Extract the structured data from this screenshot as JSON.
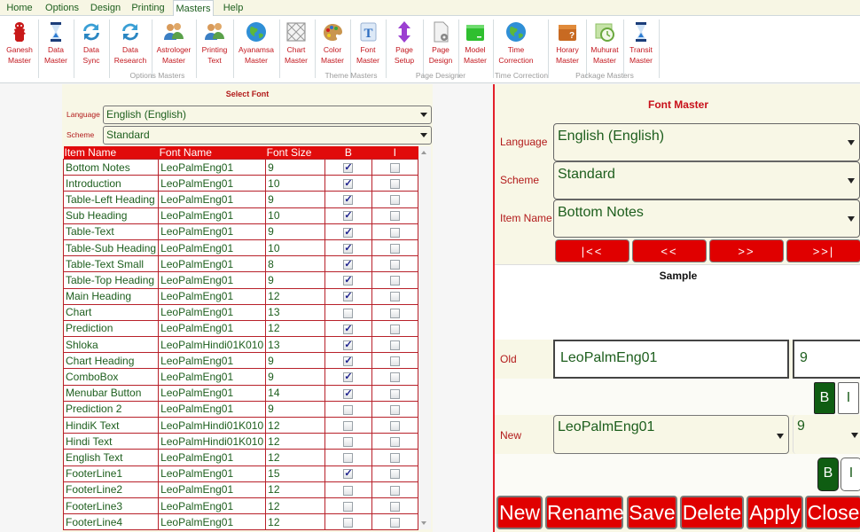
{
  "menu": {
    "tabs": [
      {
        "label": "Home",
        "active": false
      },
      {
        "label": "Options",
        "active": false
      },
      {
        "label": "Design",
        "active": false
      },
      {
        "label": "Printing",
        "active": false
      },
      {
        "label": "Masters",
        "active": true
      },
      {
        "label": "Help",
        "active": false
      }
    ]
  },
  "ribbon": {
    "buttons": [
      {
        "line1": "Ganesh",
        "line2": "Master",
        "icon": "ganesh-icon"
      },
      {
        "line1": "Data",
        "line2": "Master",
        "icon": "hourglass-icon"
      },
      {
        "line1": "Data",
        "line2": "Sync",
        "icon": "sync-icon"
      },
      {
        "line1": "Data",
        "line2": "Research",
        "icon": "sync-icon"
      },
      {
        "line1": "Astrologer",
        "line2": "Master",
        "icon": "users-icon"
      },
      {
        "line1": "Printing",
        "line2": "Text",
        "icon": "users-icon"
      },
      {
        "line1": "Ayanamsa",
        "line2": "Master",
        "icon": "globe-icon"
      },
      {
        "line1": "Chart",
        "line2": "Master",
        "icon": "chart-grid-icon"
      },
      {
        "line1": "Color",
        "line2": "Master",
        "icon": "palette-icon"
      },
      {
        "line1": "Font",
        "line2": "Master",
        "icon": "font-icon"
      },
      {
        "line1": "Page",
        "line2": "Setup",
        "icon": "vertical-arrows-icon"
      },
      {
        "line1": "Page",
        "line2": "Design",
        "icon": "page-gear-icon"
      },
      {
        "line1": "Model",
        "line2": "Master",
        "icon": "green-folder-icon"
      },
      {
        "line1": "Time",
        "line2": "Correction",
        "icon": "globe-icon"
      },
      {
        "line1": "Horary",
        "line2": "Master",
        "icon": "horary-box-icon"
      },
      {
        "line1": "Muhurat",
        "line2": "Master",
        "icon": "calendar-clock-icon"
      },
      {
        "line1": "Transit",
        "line2": "Master",
        "icon": "hourglass-icon"
      }
    ],
    "groups": [
      "Options Masters",
      "Theme Masters",
      "Page Designer",
      "Time Correction",
      "Package Masters"
    ]
  },
  "select_font": {
    "title": "Select Font",
    "language_label": "Language",
    "language_value": "English (English)",
    "scheme_label": "Scheme",
    "scheme_value": "Standard",
    "columns": [
      "Item Name",
      "Font Name",
      "Font Size",
      "B",
      "I"
    ],
    "rows": [
      {
        "item": "Bottom Notes",
        "font": "LeoPalmEng01",
        "size": "9",
        "bold": true,
        "italic": false
      },
      {
        "item": "Introduction",
        "font": "LeoPalmEng01",
        "size": "10",
        "bold": true,
        "italic": false
      },
      {
        "item": "Table-Left Heading",
        "font": "LeoPalmEng01",
        "size": "9",
        "bold": true,
        "italic": false
      },
      {
        "item": "Sub Heading",
        "font": "LeoPalmEng01",
        "size": "10",
        "bold": true,
        "italic": false
      },
      {
        "item": "Table-Text",
        "font": "LeoPalmEng01",
        "size": "9",
        "bold": true,
        "italic": false
      },
      {
        "item": "Table-Sub Heading",
        "font": "LeoPalmEng01",
        "size": "10",
        "bold": true,
        "italic": false
      },
      {
        "item": "Table-Text Small",
        "font": "LeoPalmEng01",
        "size": "8",
        "bold": true,
        "italic": false
      },
      {
        "item": "Table-Top Heading",
        "font": "LeoPalmEng01",
        "size": "9",
        "bold": true,
        "italic": false
      },
      {
        "item": "Main Heading",
        "font": "LeoPalmEng01",
        "size": "12",
        "bold": true,
        "italic": false
      },
      {
        "item": "Chart",
        "font": "LeoPalmEng01",
        "size": "13",
        "bold": false,
        "italic": false
      },
      {
        "item": "Prediction",
        "font": "LeoPalmEng01",
        "size": "12",
        "bold": true,
        "italic": false
      },
      {
        "item": "Shloka",
        "font": "LeoPalmHindi01K010",
        "size": "13",
        "bold": true,
        "italic": false
      },
      {
        "item": "Chart Heading",
        "font": "LeoPalmEng01",
        "size": "9",
        "bold": true,
        "italic": false
      },
      {
        "item": "ComboBox",
        "font": "LeoPalmEng01",
        "size": "9",
        "bold": true,
        "italic": false
      },
      {
        "item": "Menubar Button",
        "font": "LeoPalmEng01",
        "size": "14",
        "bold": true,
        "italic": false
      },
      {
        "item": "Prediction 2",
        "font": "LeoPalmEng01",
        "size": "9",
        "bold": false,
        "italic": false
      },
      {
        "item": "HindiK Text",
        "font": "LeoPalmHindi01K010",
        "size": "12",
        "bold": false,
        "italic": false
      },
      {
        "item": "Hindi Text",
        "font": "LeoPalmHindi01K010",
        "size": "12",
        "bold": false,
        "italic": false
      },
      {
        "item": "English Text",
        "font": "LeoPalmEng01",
        "size": "12",
        "bold": false,
        "italic": false
      },
      {
        "item": "FooterLine1",
        "font": "LeoPalmEng01",
        "size": "15",
        "bold": true,
        "italic": false
      },
      {
        "item": "FooterLine2",
        "font": "LeoPalmEng01",
        "size": "12",
        "bold": false,
        "italic": false
      },
      {
        "item": "FooterLine3",
        "font": "LeoPalmEng01",
        "size": "12",
        "bold": false,
        "italic": false
      },
      {
        "item": "FooterLine4",
        "font": "LeoPalmEng01",
        "size": "12",
        "bold": false,
        "italic": false
      }
    ]
  },
  "font_master": {
    "title": "Font Master",
    "language_label": "Language",
    "language_value": "English (English)",
    "scheme_label": "Scheme",
    "scheme_value": "Standard",
    "item_label": "Item Name",
    "item_value": "Bottom Notes",
    "nav": {
      "first": "|<<",
      "prev": "<<",
      "next": ">>",
      "last": ">>|"
    },
    "sample_label": "Sample",
    "old_label": "Old",
    "old_font": "LeoPalmEng01",
    "old_size": "9",
    "old_bold": true,
    "old_italic": false,
    "new_label": "New",
    "new_font": "LeoPalmEng01",
    "new_size": "9",
    "new_bold": true,
    "new_italic": false,
    "bold_label": "B",
    "italic_label": "I",
    "actions": [
      "New",
      "Rename",
      "Save",
      "Delete",
      "Apply",
      "Close"
    ]
  },
  "colors": {
    "accent_red": "#e00000",
    "label_red": "#b21a1a",
    "text_green": "#1d5e1d",
    "bold_on_green": "#0f5d12"
  }
}
